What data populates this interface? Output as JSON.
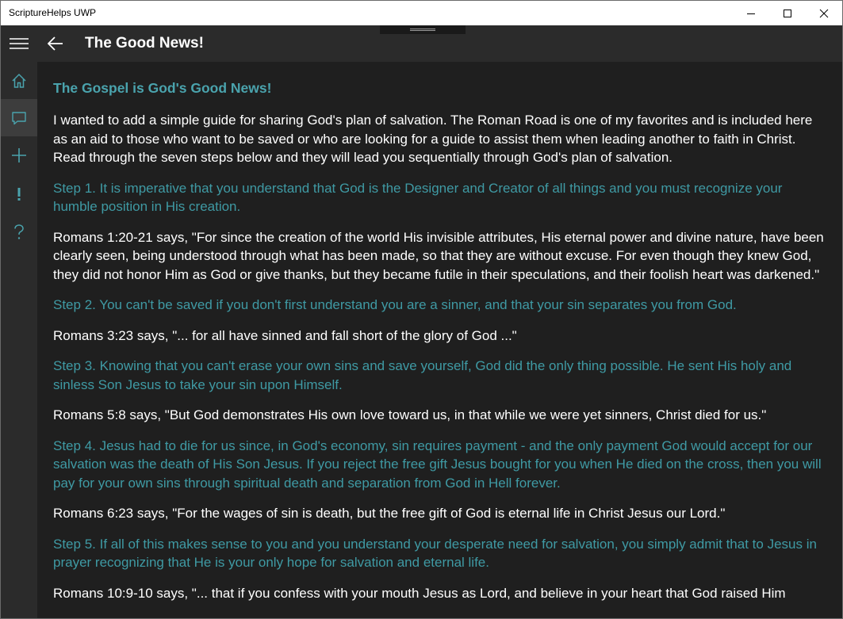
{
  "window": {
    "title": "ScriptureHelps UWP"
  },
  "icons": {
    "minimize": "minimize-icon",
    "maximize": "maximize-icon",
    "close": "close-icon",
    "menu": "hamburger-icon",
    "back": "back-arrow-icon",
    "home": "home-icon",
    "chat": "chat-icon",
    "add": "plus-icon",
    "alert": "exclamation-icon",
    "help": "question-icon"
  },
  "colors": {
    "accent": "#4aa3ad",
    "background": "#1f1f1f",
    "nav_background": "#2b2b2b"
  },
  "header": {
    "page_title": "The Good News!"
  },
  "content": {
    "heading": "The Gospel is God's Good News!",
    "paragraphs": [
      {
        "style": "white",
        "text": "I wanted to add a simple guide for sharing God's plan of salvation. The Roman Road is one of my favorites and is included here as an aid to those who want to be saved or who are looking for a guide to assist them when leading another to faith in Christ. Read through the seven steps below and they will lead you sequentially through God's plan of salvation."
      },
      {
        "style": "teal",
        "text": "Step 1. It is imperative that you understand that God is the Designer and Creator of all things and you must recognize your humble position in His creation."
      },
      {
        "style": "white",
        "text": "Romans 1:20-21 says, \"For since the creation of the world His invisible attributes, His eternal power and divine nature, have been clearly seen, being understood through what has been made, so that they are without excuse. For even though they knew God, they did not honor Him as God or give thanks, but they became futile in their speculations, and their foolish heart was darkened.\""
      },
      {
        "style": "teal",
        "text": "Step 2. You can't be saved if you don't first understand you are a sinner, and that your sin separates you from God."
      },
      {
        "style": "white",
        "text": "Romans 3:23 says, \"... for all have sinned and fall short of the glory of God ...\""
      },
      {
        "style": "teal",
        "text": "Step 3. Knowing that you can't erase your own sins and save yourself, God did the only thing possible. He sent His holy and sinless Son Jesus to take your sin upon Himself."
      },
      {
        "style": "white",
        "text": "Romans 5:8 says, \"But God demonstrates His own love toward us, in that while we were yet sinners, Christ died for us.\""
      },
      {
        "style": "teal",
        "text": "Step 4. Jesus had to die for us since, in God's economy, sin requires payment - and the only payment God would accept for our salvation was the death of His Son Jesus. If you reject the free gift Jesus bought for you when He died on the cross, then you will pay for your own sins through spiritual death and separation from God in Hell forever."
      },
      {
        "style": "white",
        "text": "Romans 6:23 says, \"For the wages of sin is death, but the free gift of God is eternal life in Christ Jesus our Lord.\""
      },
      {
        "style": "teal",
        "text": "Step 5. If all of this makes sense to you and you understand your desperate need for salvation, you simply admit that to Jesus in prayer recognizing that He is your only hope for salvation and eternal life."
      },
      {
        "style": "white",
        "text": "Romans 10:9-10 says, \"... that if you confess with your mouth Jesus as Lord, and believe in your heart that God raised Him"
      }
    ]
  }
}
